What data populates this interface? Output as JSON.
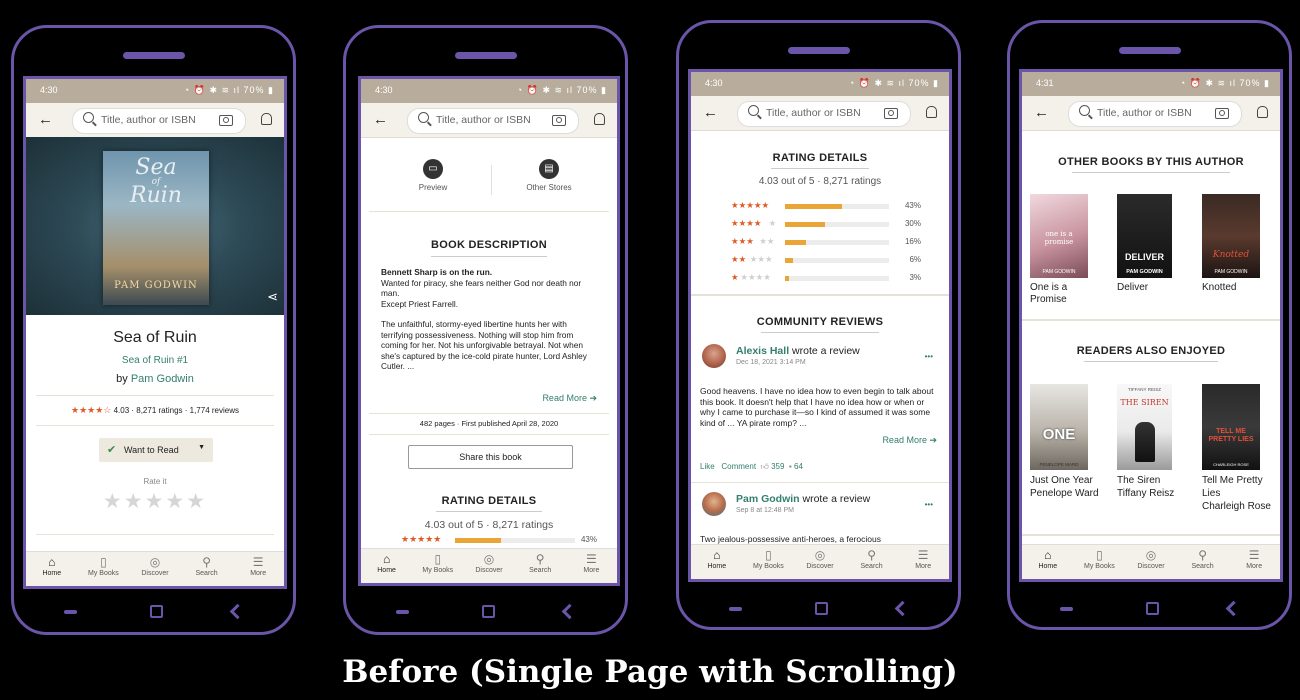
{
  "caption": "Before (Single Page with Scrolling)",
  "colors": {
    "frame": "#6a55a9",
    "statusbar": "#b8ad9c",
    "accent_green": "#337f6d",
    "star": "#e05a26",
    "bar_fill": "#e9a637"
  },
  "common": {
    "search_placeholder": "Title, author or ISBN",
    "battery": "70%",
    "tabs": [
      {
        "label": "Home",
        "icon": "home-icon"
      },
      {
        "label": "My Books",
        "icon": "book-icon"
      },
      {
        "label": "Discover",
        "icon": "compass-icon"
      },
      {
        "label": "Search",
        "icon": "search-icon"
      },
      {
        "label": "More",
        "icon": "menu-icon"
      }
    ]
  },
  "phone1": {
    "time": "4:30",
    "cover": {
      "title_line1": "Sea",
      "title_line2": "of",
      "title_line3": "Ruin",
      "author": "PAM GODWIN"
    },
    "title": "Sea of Ruin",
    "series": "Sea of Ruin #1",
    "by": "by",
    "author": "Pam Godwin",
    "stars": "★★★★☆",
    "stats": "4.03 · 8,271 ratings · 1,774 reviews",
    "shelf_button": "Want to Read",
    "rate_label": "Rate it",
    "rate_stars": "★★★★★"
  },
  "phone2": {
    "time": "4:30",
    "preview": "Preview",
    "other_stores": "Other Stores",
    "description_heading": "BOOK DESCRIPTION",
    "desc_bold": "Bennett Sharp is on the run.",
    "desc_p1": "Wanted for piracy, she fears neither God nor death nor man.",
    "desc_p2": "Except Priest Farrell.",
    "desc_p3": "The unfaithful, stormy-eyed libertine hunts her with terrifying possessiveness. Nothing will stop him from coming for her. Not his unforgivable betrayal. Not when she's captured by the ice-cold pirate hunter, Lord Ashley Cutler. ...",
    "read_more": "Read More ➔",
    "pages": "482 pages · First published April 28, 2020",
    "share": "Share this book",
    "rating_heading": "RATING DETAILS",
    "rating_summary": "4.03 out of 5 ·  8,271 ratings",
    "first_row_stars": "★★★★★",
    "first_row_pct": "43%",
    "first_row_fraction": 0.43
  },
  "phone3": {
    "time": "4:30",
    "rating_heading": "RATING DETAILS",
    "rating_summary": "4.03 out of 5 ·  8,271 ratings",
    "rating_rows": [
      {
        "stars": "★★★★★",
        "empty": "",
        "pct": "43%",
        "fraction": 0.43
      },
      {
        "stars": "★★★★",
        "empty": "★",
        "pct": "30%",
        "fraction": 0.3
      },
      {
        "stars": "★★★",
        "empty": "★★",
        "pct": "16%",
        "fraction": 0.16
      },
      {
        "stars": "★★",
        "empty": "★★★",
        "pct": "6%",
        "fraction": 0.06
      },
      {
        "stars": "★",
        "empty": "★★★★",
        "pct": "3%",
        "fraction": 0.03
      }
    ],
    "community_heading": "COMMUNITY REVIEWS",
    "review1": {
      "name": "Alexis Hall",
      "action": "wrote a review",
      "date": "Dec 18, 2021 3:14 PM",
      "text": "Good heavens. I have no idea how to even begin to talk about this book. It doesn't help that I have no idea how or when or why I came to purchase it—so I kind of assumed it was some kind of ... YA pirate romp? ...",
      "read_more": "Read More ➔",
      "like": "Like",
      "comment": "Comment",
      "likes": "359",
      "comments": "64"
    },
    "review2": {
      "name": "Pam Godwin",
      "action": "wrote a review",
      "date": "Sep 8 at 12:48 PM",
      "text": "Two jealous-possessive anti-heroes, a ferocious"
    },
    "more_dots": "•••"
  },
  "phone4": {
    "time": "4:31",
    "other_heading": "OTHER BOOKS BY THIS AUTHOR",
    "other_books": [
      {
        "title": "One is a Promise",
        "cover_text": "one is a promise",
        "cover_author": "PAM GODWIN"
      },
      {
        "title": "Deliver",
        "cover_text": "DELIVER",
        "cover_author": "PAM GODWIN"
      },
      {
        "title": "Knotted",
        "cover_text": "Knotted",
        "cover_author": "PAM GODWIN"
      }
    ],
    "readers_heading": "READERS ALSO ENJOYED",
    "readers_books": [
      {
        "title": "Just One Year",
        "author": "Penelope Ward",
        "cover_text": "ONE",
        "cover_author": "PENELOPE WARD"
      },
      {
        "title": "The Siren",
        "author": "Tiffany Reisz",
        "cover_text": "THE SIREN",
        "cover_author": "TIFFANY REISZ"
      },
      {
        "title": "Tell Me Pretty Lies",
        "author": "Charleigh Rose",
        "cover_text": "TELL ME PRETTY LIES",
        "cover_author": "CHARLEIGH ROSE"
      }
    ]
  }
}
